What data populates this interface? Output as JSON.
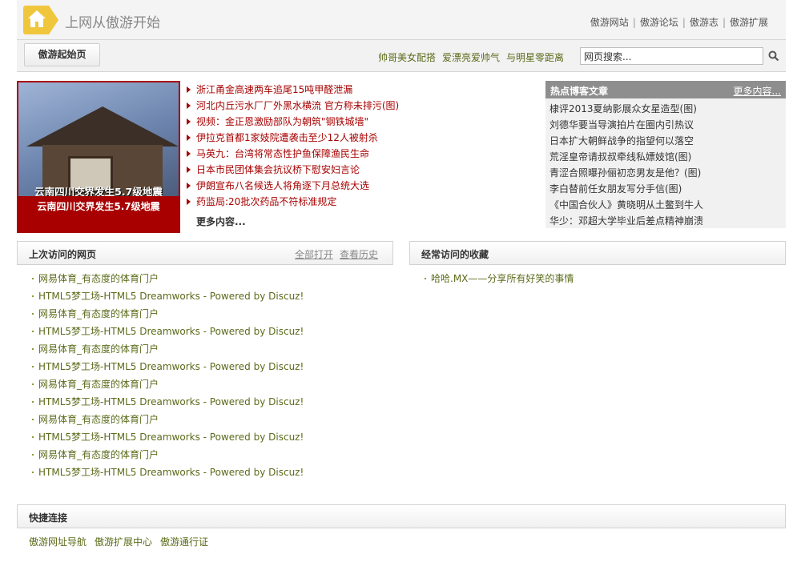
{
  "header": {
    "site_title": "上网从傲游开始",
    "nav": [
      "傲游网站",
      "傲游论坛",
      "傲游志",
      "傲游扩展"
    ]
  },
  "toolbar": {
    "home_label": "傲游起始页",
    "hot_links": [
      "帅哥美女配搭",
      "爱漂亮爱帅气",
      "与明星零距离"
    ],
    "search_placeholder": "网页搜索..."
  },
  "news": {
    "image_caption": "云南四川交界发生5.7级地震",
    "headlines": [
      "浙江甬金高速两车追尾15吨甲醛泄漏",
      "河北内丘污水厂厂外黑水横流 官方称未排污(图)",
      "视频：金正恩激励部队为朝筑\"钢铁城墙\"",
      "伊拉克首都1家妓院遭袭击至少12人被射杀",
      "马英九：台湾将常态性护鱼保障渔民生命",
      "日本市民团体集会抗议桥下慰安妇言论",
      "伊朗宣布八名候选人将角逐下月总统大选",
      "药监局:20批次药品不符标准规定"
    ],
    "more_label": "更多内容..."
  },
  "blog": {
    "title": "热点博客文章",
    "more_label": "更多内容...",
    "items": [
      "棣评2013夏纳影展众女星造型(图)",
      "刘德华要当导演拍片在圈内引热议",
      "日本扩大朝鲜战争的指望何以落空",
      "荒淫皇帝请叔叔牵线私嫖妓馆(图)",
      "青涩合照曝孙俪初恋男友是他？(图)",
      "李白替前任女朋友写分手信(图)",
      "《中国合伙人》黄晓明从土鳖到牛人",
      "华少：邓超大学毕业后差点精神崩溃"
    ]
  },
  "recent": {
    "title": "上次访问的网页",
    "open_all_label": "全部打开",
    "history_label": "查看历史",
    "items": [
      "网易体育_有态度的体育门户",
      "HTML5梦工场-HTML5 Dreamworks - Powered by Discuz!",
      "网易体育_有态度的体育门户",
      "HTML5梦工场-HTML5 Dreamworks - Powered by Discuz!",
      "网易体育_有态度的体育门户",
      "HTML5梦工场-HTML5 Dreamworks - Powered by Discuz!",
      "网易体育_有态度的体育门户",
      "HTML5梦工场-HTML5 Dreamworks - Powered by Discuz!",
      "网易体育_有态度的体育门户",
      "HTML5梦工场-HTML5 Dreamworks - Powered by Discuz!",
      "网易体育_有态度的体育门户",
      "HTML5梦工场-HTML5 Dreamworks - Powered by Discuz!"
    ]
  },
  "favorites": {
    "title": "经常访问的收藏",
    "items": [
      "哈哈.MX——分享所有好笑的事情"
    ]
  },
  "quick": {
    "title": "快捷连接",
    "links": [
      "傲游网址导航",
      "傲游扩展中心",
      "傲游通行证"
    ]
  },
  "colors": {
    "accent_red": "#a80000",
    "link_green": "#5b6b1a",
    "logo_yellow": "#f0c63c"
  }
}
